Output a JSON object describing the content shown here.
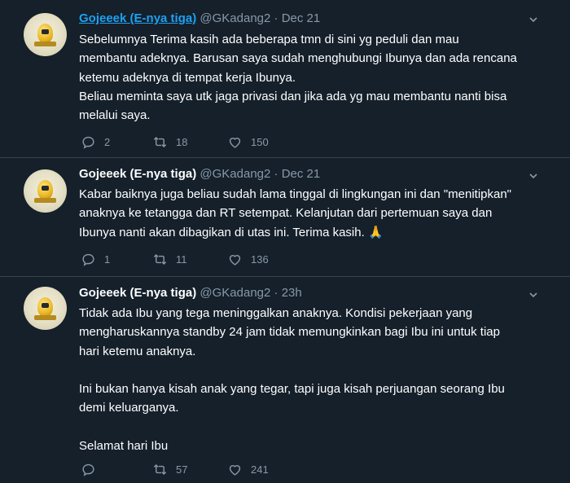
{
  "tweets": [
    {
      "name": "Gojeeek (E-nya tiga)",
      "handle": "@GKadang2",
      "separator": "·",
      "time": "Dec 21",
      "text": "Sebelumnya Terima kasih ada beberapa tmn di sini yg peduli dan mau\nmembantu adeknya. Barusan saya sudah menghubungi Ibunya dan ada rencana\nketemu adeknya di tempat kerja Ibunya.\nBeliau meminta saya utk jaga privasi dan jika ada yg mau membantu nanti bisa\nmelalui saya.",
      "replies": "2",
      "retweets": "18",
      "likes": "150"
    },
    {
      "name": "Gojeeek (E-nya tiga)",
      "handle": "@GKadang2",
      "separator": "·",
      "time": "Dec 21",
      "text": "Kabar baiknya juga beliau sudah lama tinggal di lingkungan ini dan \"menitipkan\"\nanaknya ke tetangga dan RT setempat. Kelanjutan dari pertemuan saya dan\nIbunya nanti akan dibagikan di utas ini. Terima kasih.",
      "emoji": "🙏",
      "replies": "1",
      "retweets": "11",
      "likes": "136"
    },
    {
      "name": "Gojeeek (E-nya tiga)",
      "handle": "@GKadang2",
      "separator": "·",
      "time": "23h",
      "text": "Tidak ada Ibu yang tega meninggalkan anaknya. Kondisi pekerjaan yang\nmengharuskannya standby 24 jam tidak memungkinkan bagi Ibu ini untuk tiap\nhari ketemu anaknya.\n\nIni bukan hanya kisah anak yang tegar, tapi juga kisah perjuangan seorang Ibu\ndemi keluarganya.\n\nSelamat hari Ibu",
      "replies": "",
      "retweets": "57",
      "likes": "241"
    }
  ],
  "icons": {
    "reply": "reply-icon",
    "retweet": "retweet-icon",
    "like": "heart-icon",
    "more": "chevron-down-icon",
    "avatar": "avatar-image"
  },
  "colors": {
    "background": "#15202b",
    "secondary_text": "#8899a6",
    "link": "#1da1f2",
    "divider": "#38444d"
  }
}
